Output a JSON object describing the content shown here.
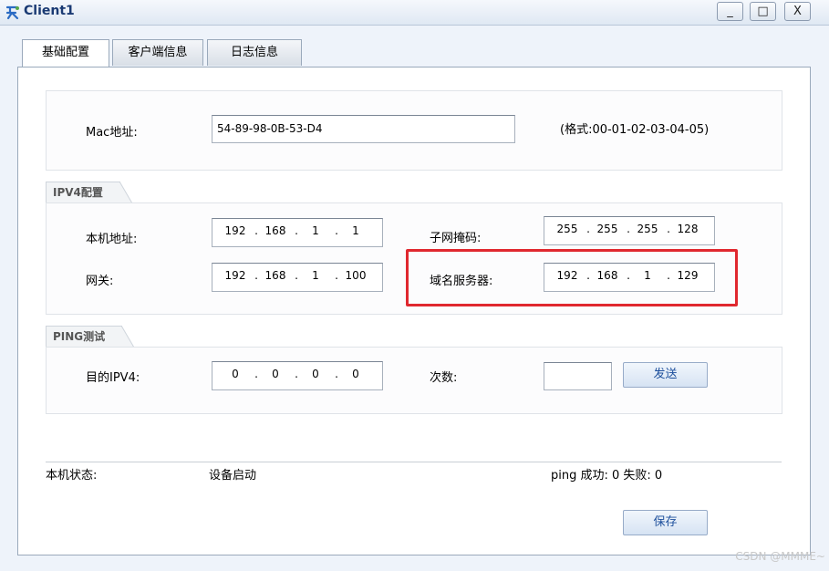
{
  "window": {
    "title": "Client1"
  },
  "window_controls": {
    "minimize": "_",
    "maximize": "□",
    "close": "X"
  },
  "tabs": [
    {
      "label": "基础配置",
      "active": true
    },
    {
      "label": "客户端信息",
      "active": false
    },
    {
      "label": "日志信息",
      "active": false
    }
  ],
  "mac": {
    "label": "Mac地址:",
    "value": "54-89-98-0B-53-D4",
    "hint": "(格式:00-01-02-03-04-05)"
  },
  "ipv4": {
    "legend": "IPV4配置",
    "host_label": "本机地址:",
    "host_ip": [
      "192",
      "168",
      "1",
      "1"
    ],
    "mask_label": "子网掩码:",
    "mask": [
      "255",
      "255",
      "255",
      "128"
    ],
    "gateway_label": "网关:",
    "gateway": [
      "192",
      "168",
      "1",
      "100"
    ],
    "dns_label": "域名服务器:",
    "dns": [
      "192",
      "168",
      "1",
      "129"
    ]
  },
  "ping": {
    "legend": "PING测试",
    "dest_label": "目的IPV4:",
    "dest": [
      "0",
      "0",
      "0",
      "0"
    ],
    "count_label": "次数:",
    "count_value": "",
    "send_button": "发送"
  },
  "status": {
    "label": "本机状态:",
    "value": "设备启动",
    "ping_result": "ping 成功: 0 失败: 0"
  },
  "save_button": "保存",
  "watermark": "CSDN @MMME~"
}
